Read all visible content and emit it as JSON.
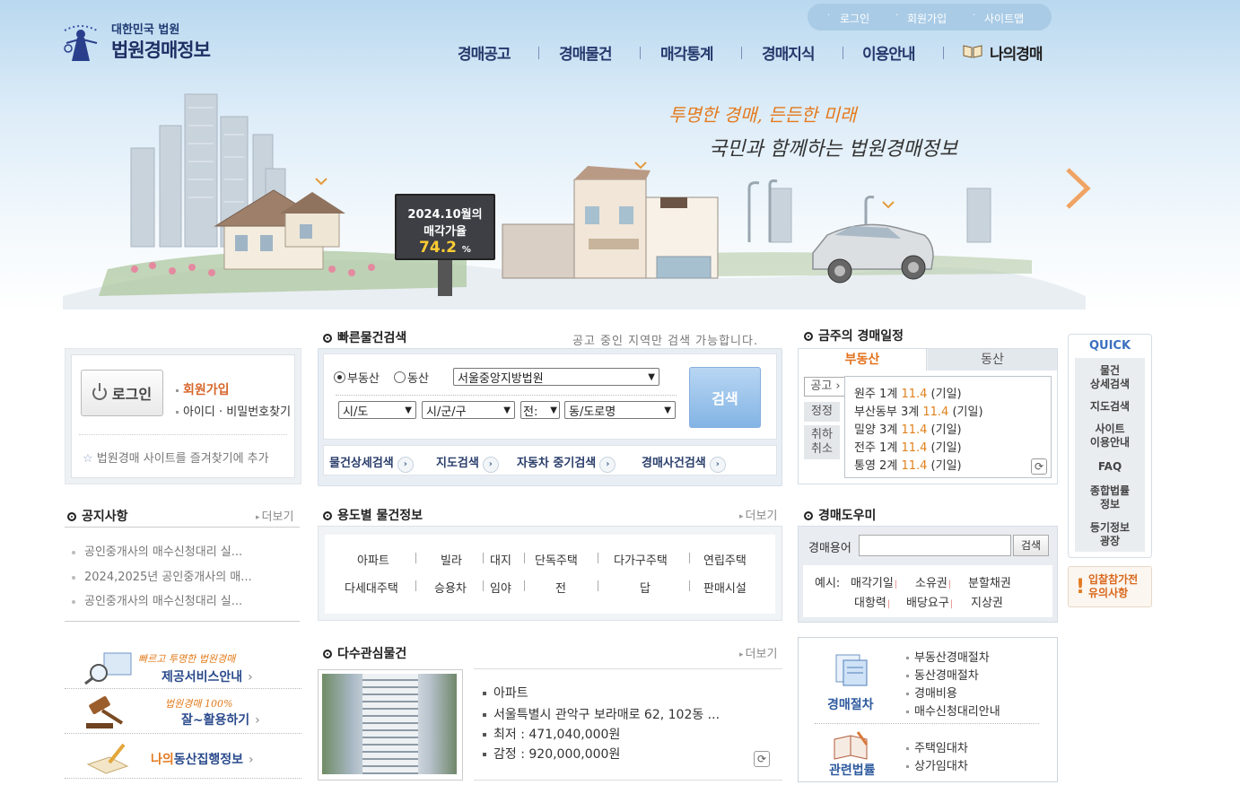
{
  "header": {
    "logo_sub": "대한민국 법원",
    "logo_main": "법원경매정보",
    "util_links": [
      "로그인",
      "회원가입",
      "사이트맵"
    ],
    "nav": [
      "경매공고",
      "경매물건",
      "매각통계",
      "경매지식",
      "이용안내",
      "나의경매"
    ]
  },
  "hero": {
    "slogan_line1": "투명한 경매, 든든한 미래",
    "slogan_line2": "국민과 함께하는 법원경매정보",
    "billboard_line1": "2024.10월의",
    "billboard_line2": "매각가율",
    "billboard_value": "74.2",
    "billboard_unit": "%"
  },
  "login": {
    "login_button": "로그인",
    "join": "회원가입",
    "find": "아이디 · 비밀번호찾기",
    "favorite": "법원경매 사이트를 즐겨찾기에 추가"
  },
  "notice": {
    "title": "공지사항",
    "more": "더보기",
    "items": [
      "공인중개사의 매수신청대리 실...",
      "2024,2025년 공인중개사의 매...",
      "공인중개사의 매수신청대리 실..."
    ]
  },
  "banners": [
    {
      "caption": "빠르고 투명한 법원경매",
      "label": "제공서비스안내"
    },
    {
      "caption": "법원경매 100%",
      "label": "잘~활용하기"
    },
    {
      "caption": "",
      "label_prefix": "나의",
      "label": "동산집행정보"
    }
  ],
  "quick_search": {
    "title": "빠른물건검색",
    "note": "공고 중인 지역만 검색 가능합니다.",
    "radio_realestate": "부동산",
    "radio_movable": "동산",
    "court": "서울중앙지방법원",
    "sido": "시/도",
    "sigungu": "시/군/구",
    "eup": "전:",
    "dong": "동/도로명",
    "search_button": "검색",
    "links": [
      "물건상세검색",
      "지도검색",
      "자동차 중기검색",
      "경매사건검색"
    ]
  },
  "usage": {
    "title": "용도별 물건정보",
    "more": "더보기",
    "row1": [
      "아파트",
      "빌라",
      "대지",
      "단독주택",
      "다가구주택",
      "연립주택"
    ],
    "row2": [
      "다세대주택",
      "승용차",
      "임야",
      "전",
      "답",
      "판매시설"
    ]
  },
  "interest": {
    "title": "다수관심물건",
    "more": "더보기",
    "type": "아파트",
    "address": "서울특별시 관악구 보라매로 62, 102동 ...",
    "min_price": "최저 : 471,040,000원",
    "appraisal": "감정 : 920,000,000원"
  },
  "schedule": {
    "title": "금주의 경매일정",
    "tab_realestate": "부동산",
    "tab_movable": "동산",
    "tags": [
      "공고",
      "정정",
      "취하취소"
    ],
    "rows": [
      {
        "court": "원주 1계",
        "date": "11.4",
        "type": "(기일)"
      },
      {
        "court": "부산동부 3계",
        "date": "11.4",
        "type": "(기일)"
      },
      {
        "court": "밀양 3계",
        "date": "11.4",
        "type": "(기일)"
      },
      {
        "court": "전주 1계",
        "date": "11.4",
        "type": "(기일)"
      },
      {
        "court": "통영 2계",
        "date": "11.4",
        "type": "(기일)"
      }
    ]
  },
  "helper": {
    "title": "경매도우미",
    "label": "경매용어",
    "input_value": "",
    "button": "검색",
    "example_prefix": "예시:",
    "row1": [
      "매각기일",
      "소유권",
      "분할채권"
    ],
    "row2": [
      "대항력",
      "배당요구",
      "지상권"
    ]
  },
  "procedure": {
    "caption1": "경매절차",
    "links1": [
      "부동산경매절차",
      "동산경매절차",
      "경매비용",
      "매수신청대리안내"
    ],
    "caption2": "관련법률",
    "links2": [
      "주택임대차",
      "상가임대차"
    ]
  },
  "quick": {
    "title": "QUICK",
    "items": [
      "물건\n상세검색",
      "지도검색",
      "사이트\n이용안내",
      "FAQ",
      "종합법률\n정보",
      "등기정보\n광장"
    ],
    "notice": "입찰참가전\n유의사항"
  },
  "colors": {
    "accent_orange": "#e4711c",
    "nav_blue": "#24386b",
    "search_button": "#83b4e4"
  }
}
